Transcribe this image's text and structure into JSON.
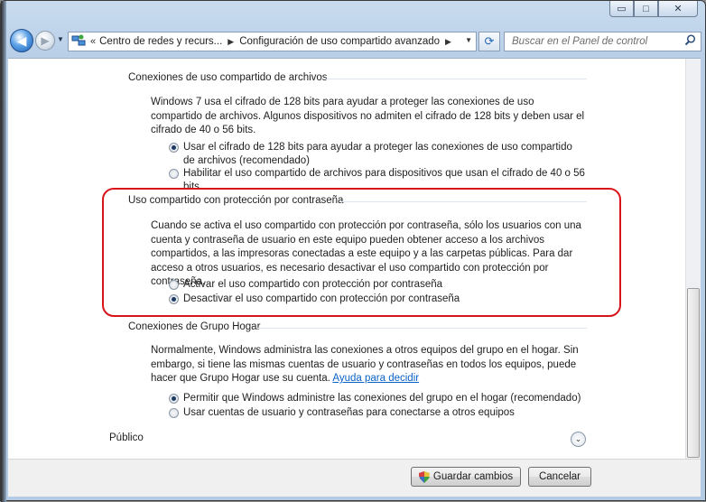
{
  "window": {
    "caption_buttons": {
      "minimize": "▭",
      "maximize": "□",
      "close": "✕"
    }
  },
  "nav": {
    "back_icon": "◀",
    "forward_icon": "▶",
    "breadcrumb_chevron": "«",
    "crumbs": [
      "Centro de redes y recurs...",
      "Configuración de uso compartido avanzado"
    ],
    "separator": "▶",
    "dropdown_icon": "▼",
    "refresh_icon": "⟳",
    "search_placeholder": "Buscar en el Panel de control",
    "search_icon": "⚲"
  },
  "sections": {
    "file_sharing": {
      "title": "Conexiones de uso compartido de archivos",
      "description": "Windows 7 usa el cifrado de 128 bits para ayudar a proteger las conexiones de uso compartido de archivos. Algunos dispositivos no admiten el cifrado de 128 bits y deben usar el cifrado de 40 o 56 bits.",
      "options": [
        {
          "label": "Usar el cifrado de 128 bits para ayudar a proteger las conexiones de uso compartido de archivos (recomendado)",
          "selected": true
        },
        {
          "label": "Habilitar el uso compartido de archivos para dispositivos que usan el cifrado de 40 o 56 bits",
          "selected": false
        }
      ]
    },
    "password_sharing": {
      "title": "Uso compartido con protección por contraseña",
      "description": "Cuando se activa el uso compartido con protección por contraseña, sólo los usuarios con una cuenta y contraseña de usuario en este equipo pueden obtener acceso a los archivos compartidos, a las impresoras conectadas a este equipo y a las carpetas públicas. Para dar acceso a otros usuarios, es necesario desactivar el uso compartido con protección por contraseña.",
      "options": [
        {
          "label": "Activar el uso compartido con protección por contraseña",
          "selected": false
        },
        {
          "label": "Desactivar el uso compartido con protección por contraseña",
          "selected": true
        }
      ],
      "highlight_color": "#d9151a"
    },
    "homegroup": {
      "title": "Conexiones de Grupo Hogar",
      "description": "Normalmente, Windows administra las conexiones a otros equipos del grupo en el hogar. Sin embargo, si tiene las mismas cuentas de usuario y contraseñas en todos los equipos, puede hacer que Grupo Hogar use su cuenta.",
      "help_link": "Ayuda para decidir",
      "options": [
        {
          "label": "Permitir que Windows administre las conexiones del grupo en el hogar (recomendado)",
          "selected": true
        },
        {
          "label": "Usar cuentas de usuario y contraseñas para conectarse a otros equipos",
          "selected": false
        }
      ]
    },
    "public": {
      "title": "Público",
      "expander_icon": "⌄"
    }
  },
  "footer": {
    "save_label": "Guardar cambios",
    "cancel_label": "Cancelar"
  }
}
